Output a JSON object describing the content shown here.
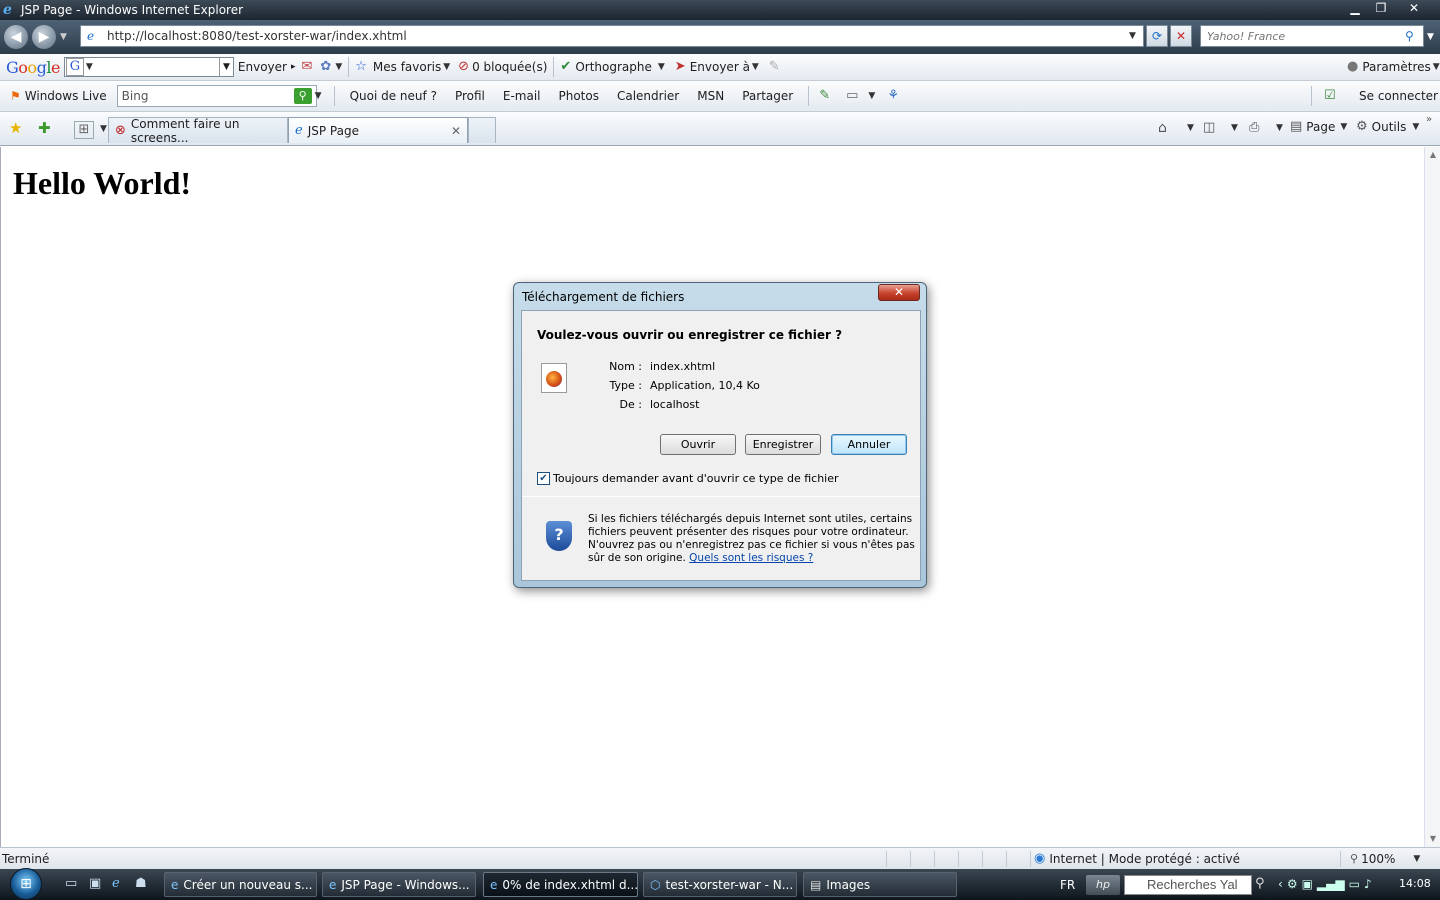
{
  "window": {
    "title": "JSP Page - Windows Internet Explorer",
    "minimize": "▁",
    "restore": "❐",
    "close": "✕"
  },
  "address": {
    "url": "http://localhost:8080/test-xorster-war/index.xhtml",
    "search_placeholder": "Yahoo! France"
  },
  "google_toolbar": {
    "logo": [
      "G",
      "o",
      "o",
      "g",
      "l",
      "e"
    ],
    "search_label": "G",
    "send": "Envoyer",
    "favorites": "Mes favoris",
    "blocked": "0 bloquée(s)",
    "spelling": "Orthographe",
    "send_to": "Envoyer à",
    "settings": "Paramètres"
  },
  "live_toolbar": {
    "brand": "Windows Live",
    "search_value": "Bing",
    "links": [
      "Quoi de neuf ?",
      "Profil",
      "E-mail",
      "Photos",
      "Calendrier",
      "MSN",
      "Partager"
    ],
    "signin": "Se connecter"
  },
  "tabs": [
    {
      "label": "Comment faire un screens...",
      "active": false
    },
    {
      "label": "JSP Page",
      "active": true
    }
  ],
  "command_bar": {
    "page": "Page",
    "tools": "Outils"
  },
  "page": {
    "heading": "Hello World!"
  },
  "dialog": {
    "title": "Téléchargement de fichiers",
    "question": "Voulez-vous ouvrir ou enregistrer ce fichier ?",
    "fields": [
      {
        "label": "Nom :",
        "value": "index.xhtml"
      },
      {
        "label": "Type :",
        "value": "Application, 10,4 Ko"
      },
      {
        "label": "De :",
        "value": "localhost"
      }
    ],
    "buttons": {
      "open": "Ouvrir",
      "save": "Enregistrer",
      "cancel": "Annuler"
    },
    "checkbox_label": "Toujours demander avant d'ouvrir ce type de fichier",
    "checkbox_checked": true,
    "warning_text": "Si les fichiers téléchargés depuis Internet sont utiles, certains fichiers peuvent présenter des risques pour votre ordinateur. N'ouvrez pas ou n'enregistrez pas ce fichier si vous n'êtes pas sûr de son origine.",
    "risk_link": "Quels sont les risques ?"
  },
  "status": {
    "text": "Terminé",
    "zone": "Internet | Mode protégé : activé",
    "zoom": "100%"
  },
  "taskbar": {
    "tasks": [
      {
        "label": "Créer un nouveau s...",
        "active": false
      },
      {
        "label": "JSP Page - Windows...",
        "active": false
      },
      {
        "label": "0% de index.xhtml d...",
        "active": true
      },
      {
        "label": "test-xorster-war - N...",
        "active": false
      },
      {
        "label": "Images",
        "active": false
      }
    ],
    "lang": "FR",
    "search": "Recherches Yal",
    "clock": "14:08"
  },
  "colors": {
    "title_bar": "#1b2530",
    "dialog_frame": "#a9c6da",
    "link": "#0645ad",
    "close_red": "#c7432e"
  }
}
